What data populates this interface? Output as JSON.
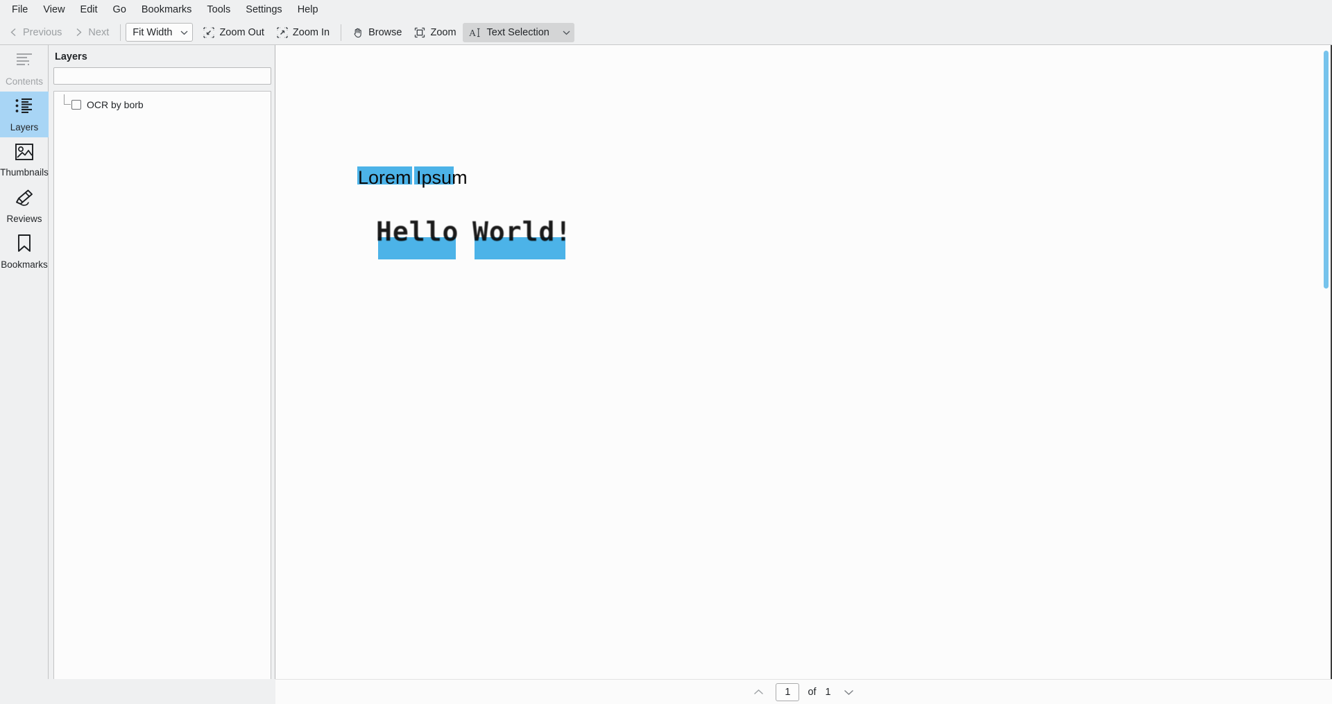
{
  "menubar": {
    "items": [
      {
        "label": "File",
        "name": "menu-file"
      },
      {
        "label": "View",
        "name": "menu-view"
      },
      {
        "label": "Edit",
        "name": "menu-edit"
      },
      {
        "label": "Go",
        "name": "menu-go"
      },
      {
        "label": "Bookmarks",
        "name": "menu-bookmarks"
      },
      {
        "label": "Tools",
        "name": "menu-tools"
      },
      {
        "label": "Settings",
        "name": "menu-settings"
      },
      {
        "label": "Help",
        "name": "menu-help"
      }
    ]
  },
  "toolbar": {
    "previous_label": "Previous",
    "next_label": "Next",
    "zoom_mode_value": "Fit Width",
    "zoom_out_label": "Zoom Out",
    "zoom_in_label": "Zoom In",
    "browse_label": "Browse",
    "zoom_label": "Zoom",
    "text_selection_label": "Text Selection",
    "icons": {
      "previous": "chevron-left-icon",
      "next": "chevron-right-icon",
      "zoom_out": "zoom-out-icon",
      "zoom_in": "zoom-in-icon",
      "browse": "hand-icon",
      "zoom": "marquee-zoom-icon",
      "text_selection": "text-cursor-icon",
      "dropdown": "chevron-down-icon"
    }
  },
  "sidebar": {
    "items": [
      {
        "label": "Contents",
        "name": "sidebar-item-contents",
        "icon": "contents-icon",
        "state": "disabled"
      },
      {
        "label": "Layers",
        "name": "sidebar-item-layers",
        "icon": "layers-list-icon",
        "state": "selected"
      },
      {
        "label": "Thumbnails",
        "name": "sidebar-item-thumbnails",
        "icon": "image-icon",
        "state": "normal"
      },
      {
        "label": "Reviews",
        "name": "sidebar-item-reviews",
        "icon": "highlighter-pen-icon",
        "state": "normal"
      },
      {
        "label": "Bookmarks",
        "name": "sidebar-item-bookmarks",
        "icon": "bookmark-ribbon-icon",
        "state": "normal"
      }
    ]
  },
  "panel": {
    "title": "Layers",
    "search_placeholder": "",
    "search_value": "",
    "tree": [
      {
        "label": "OCR by borb",
        "checked": false
      }
    ]
  },
  "document": {
    "heading": "Lorem Ipsum",
    "ocr_words": [
      "Hello",
      "World!"
    ],
    "selection_color": "#4cb3e8"
  },
  "statusbar": {
    "current_page": "1",
    "of_label": "of",
    "total_pages": "1",
    "prev_icon": "chevron-up-icon",
    "next_icon": "chevron-down-icon"
  }
}
